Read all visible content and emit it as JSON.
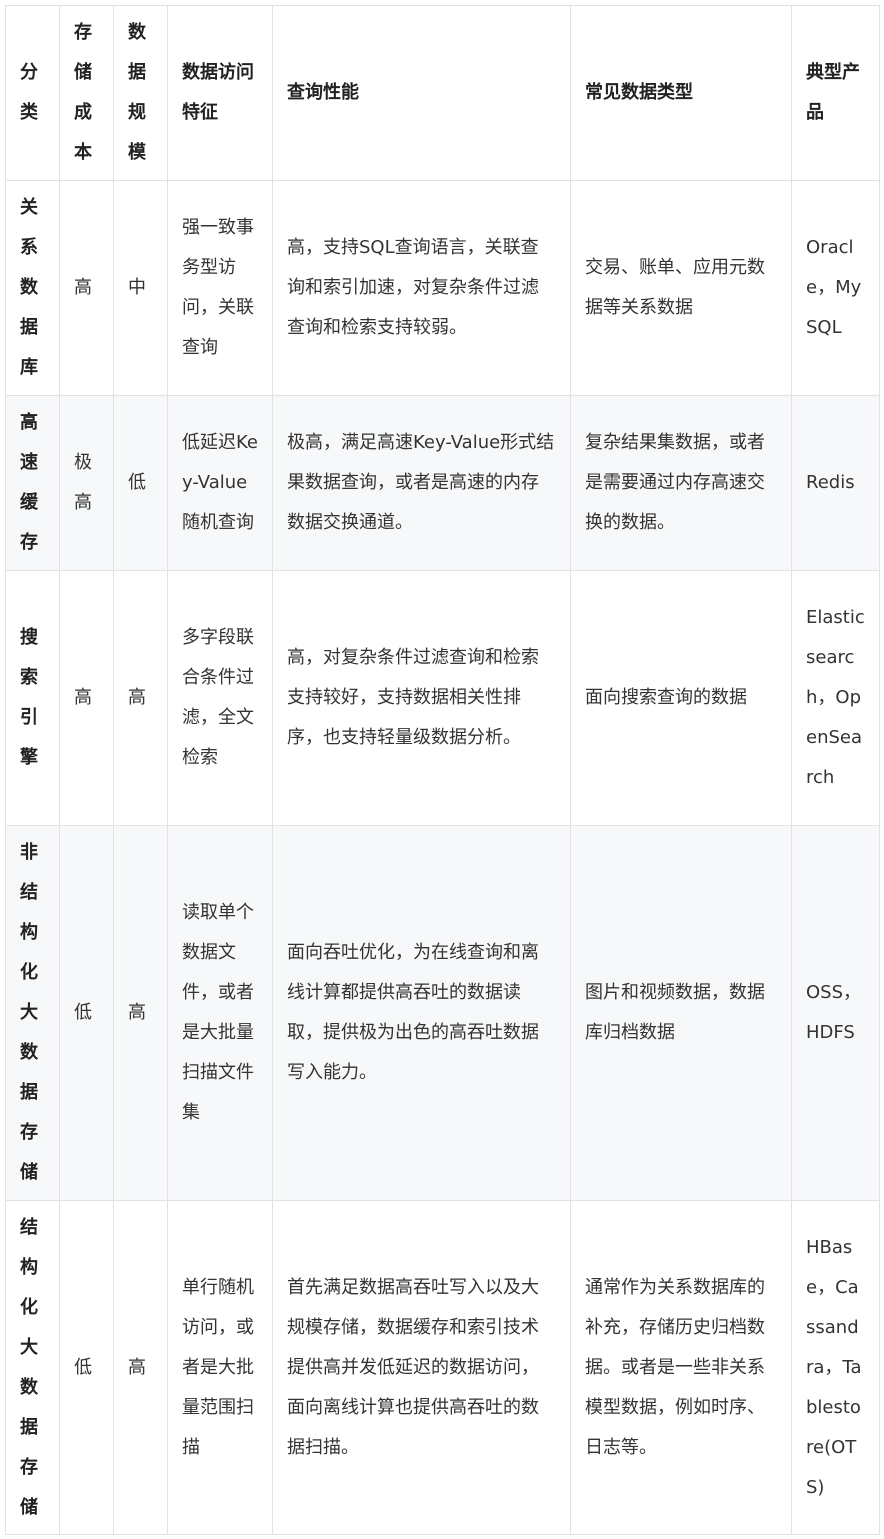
{
  "table": {
    "headers": [
      "分类",
      "存储成本",
      "数据规模",
      "数据访问特征",
      "查询性能",
      "常见数据类型",
      "典型产品"
    ],
    "rows": [
      {
        "category": "关系数据库",
        "cost": "高",
        "scale": "中",
        "access": "强一致事务型访问，关联查询",
        "query": "高，支持SQL查询语言，关联查询和索引加速，对复杂条件过滤查询和检索支持较弱。",
        "types": "交易、账单、应用元数据等关系数据",
        "products": "Oracle，MySQL"
      },
      {
        "category": "高速缓存",
        "cost": "极高",
        "scale": "低",
        "access": "低延迟Key-Value随机查询",
        "query": "极高，满足高速Key-Value形式结果数据查询，或者是高速的内存数据交换通道。",
        "types": "复杂结果集数据，或者是需要通过内存高速交换的数据。",
        "products": "Redis"
      },
      {
        "category": "搜索引擎",
        "cost": "高",
        "scale": "高",
        "access": "多字段联合条件过滤，全文检索",
        "query": "高，对复杂条件过滤查询和检索支持较好，支持数据相关性排序，也支持轻量级数据分析。",
        "types": "面向搜索查询的数据",
        "products": "Elasticsearch，OpenSearch"
      },
      {
        "category": "非结构化大数据存储",
        "cost": "低",
        "scale": "高",
        "access": "读取单个数据文件，或者是大批量扫描文件集",
        "query": "面向吞吐优化，为在线查询和离线计算都提供高吞吐的数据读取，提供极为出色的高吞吐数据写入能力。",
        "types": "图片和视频数据，数据库归档数据",
        "products": "OSS，HDFS"
      },
      {
        "category": "结构化大数据存储",
        "cost": "低",
        "scale": "高",
        "access": "单行随机访问，或者是大批量范围扫描",
        "query": "首先满足数据高吞吐写入以及大规模存储，数据缓存和索引技术提供高并发低延迟的数据访问，面向离线计算也提供高吞吐的数据扫描。",
        "types": "通常作为关系数据库的补充，存储历史归档数据。或者是一些非关系模型数据，例如时序、日志等。",
        "products": "HBase，Cassandra，Tablestore(OTS)"
      }
    ]
  }
}
